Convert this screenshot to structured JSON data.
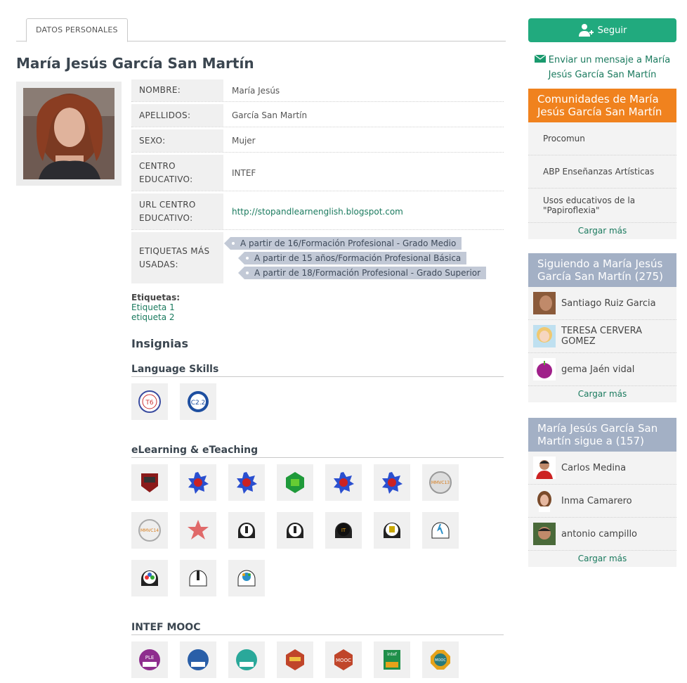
{
  "tabs": [
    {
      "label": "DATOS PERSONALES"
    }
  ],
  "profile": {
    "name": "María Jesús García San Martín",
    "fields": [
      {
        "label": "NOMBRE:",
        "value": "María Jesús"
      },
      {
        "label": "APELLIDOS:",
        "value": "García San Martín"
      },
      {
        "label": "SEXO:",
        "value": "Mujer"
      },
      {
        "label": "CENTRO EDUCATIVO:",
        "value": "INTEF"
      },
      {
        "label": "URL CENTRO EDUCATIVO:",
        "value": "http://stopandlearnenglish.blogspot.com"
      },
      {
        "label": "ETIQUETAS MÁS USADAS:",
        "value": ""
      }
    ],
    "top_tags": [
      "A partir de 16/Formación Profesional - Grado Medio",
      "A partir de 15 años/Formación Profesional Básica",
      "A partir de 18/Formación Profesional - Grado Superior"
    ],
    "etiquetas_label": "Etiquetas:",
    "etiquetas": [
      "Etiqueta 1",
      "etiqueta 2"
    ]
  },
  "insignias": {
    "title": "Insignias",
    "sections": [
      {
        "title": "Language Skills",
        "badges": [
          "T6",
          "C2.2"
        ]
      },
      {
        "title": "eLearning & eTeaching",
        "badges": [
          "",
          "",
          "",
          "",
          "",
          "",
          "MMVC13",
          "MMVC14",
          "",
          "",
          "",
          "",
          "",
          "",
          "",
          "",
          ""
        ]
      },
      {
        "title": "INTEF MOOC",
        "badges": [
          "PLE",
          "",
          "",
          "",
          "MOOC",
          "intef",
          "MOOC"
        ]
      }
    ]
  },
  "sidebar": {
    "follow_label": "Seguir",
    "message_link": "Enviar un mensaje a María Jesús García San Martín",
    "communities": {
      "title": "Comunidades de María Jesús García San Martín",
      "items": [
        "Procomun",
        "ABP Enseñanzas Artísticas",
        "Usos educativos de la \"Papiroflexia\""
      ],
      "more": "Cargar más"
    },
    "followers": {
      "title": "Siguiendo a María Jesús García San Martín (275)",
      "items": [
        "Santiago Ruiz Garcia",
        "TERESA CERVERA GOMEZ",
        "gema Jaén vidal"
      ],
      "more": "Cargar más"
    },
    "following": {
      "title": "María Jesús García San Martín sigue a (157)",
      "items": [
        "Carlos Medina",
        "Inma Camarero",
        "antonio campillo"
      ],
      "more": "Cargar más"
    }
  },
  "colors": {
    "accent": "#21aa7e",
    "link": "#1a7a5e",
    "orange": "#f0821e",
    "panel_blue": "#a3b0c5"
  }
}
